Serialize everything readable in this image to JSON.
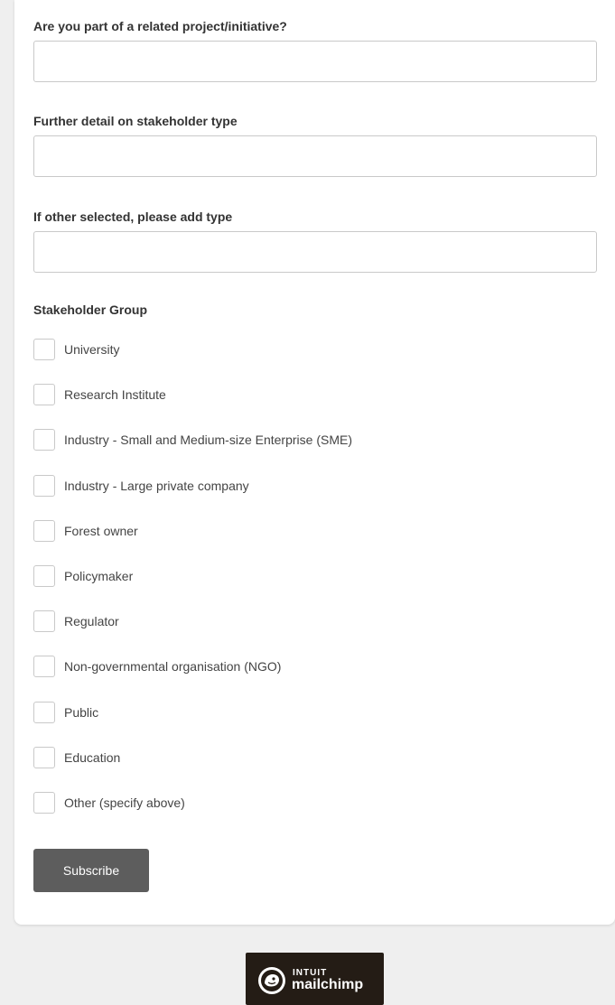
{
  "fields": [
    {
      "label": "Are you part of a related project/initiative?",
      "value": ""
    },
    {
      "label": "Further detail on stakeholder type",
      "value": ""
    },
    {
      "label": "If other selected, please add type",
      "value": ""
    }
  ],
  "stakeholder_group": {
    "label": "Stakeholder Group",
    "options": [
      {
        "label": "University",
        "checked": false
      },
      {
        "label": "Research Institute",
        "checked": false
      },
      {
        "label": "Industry - Small and Medium-size Enterprise (SME)",
        "checked": false
      },
      {
        "label": "Industry - Large private company",
        "checked": false
      },
      {
        "label": "Forest owner",
        "checked": false
      },
      {
        "label": "Policymaker",
        "checked": false
      },
      {
        "label": "Regulator",
        "checked": false
      },
      {
        "label": "Non-governmental organisation (NGO)",
        "checked": false
      },
      {
        "label": "Public",
        "checked": false
      },
      {
        "label": "Education",
        "checked": false
      },
      {
        "label": "Other (specify above)",
        "checked": false
      }
    ]
  },
  "submit": {
    "label": "Subscribe"
  },
  "footer": {
    "badge_top": "INTUIT",
    "badge_main": "mailchimp",
    "badge_icon": "mailchimp-freddie-icon"
  },
  "colors": {
    "page_bg": "#efefef",
    "card_bg": "#ffffff",
    "button_bg": "#5d5d5d",
    "badge_bg": "#241c15"
  }
}
